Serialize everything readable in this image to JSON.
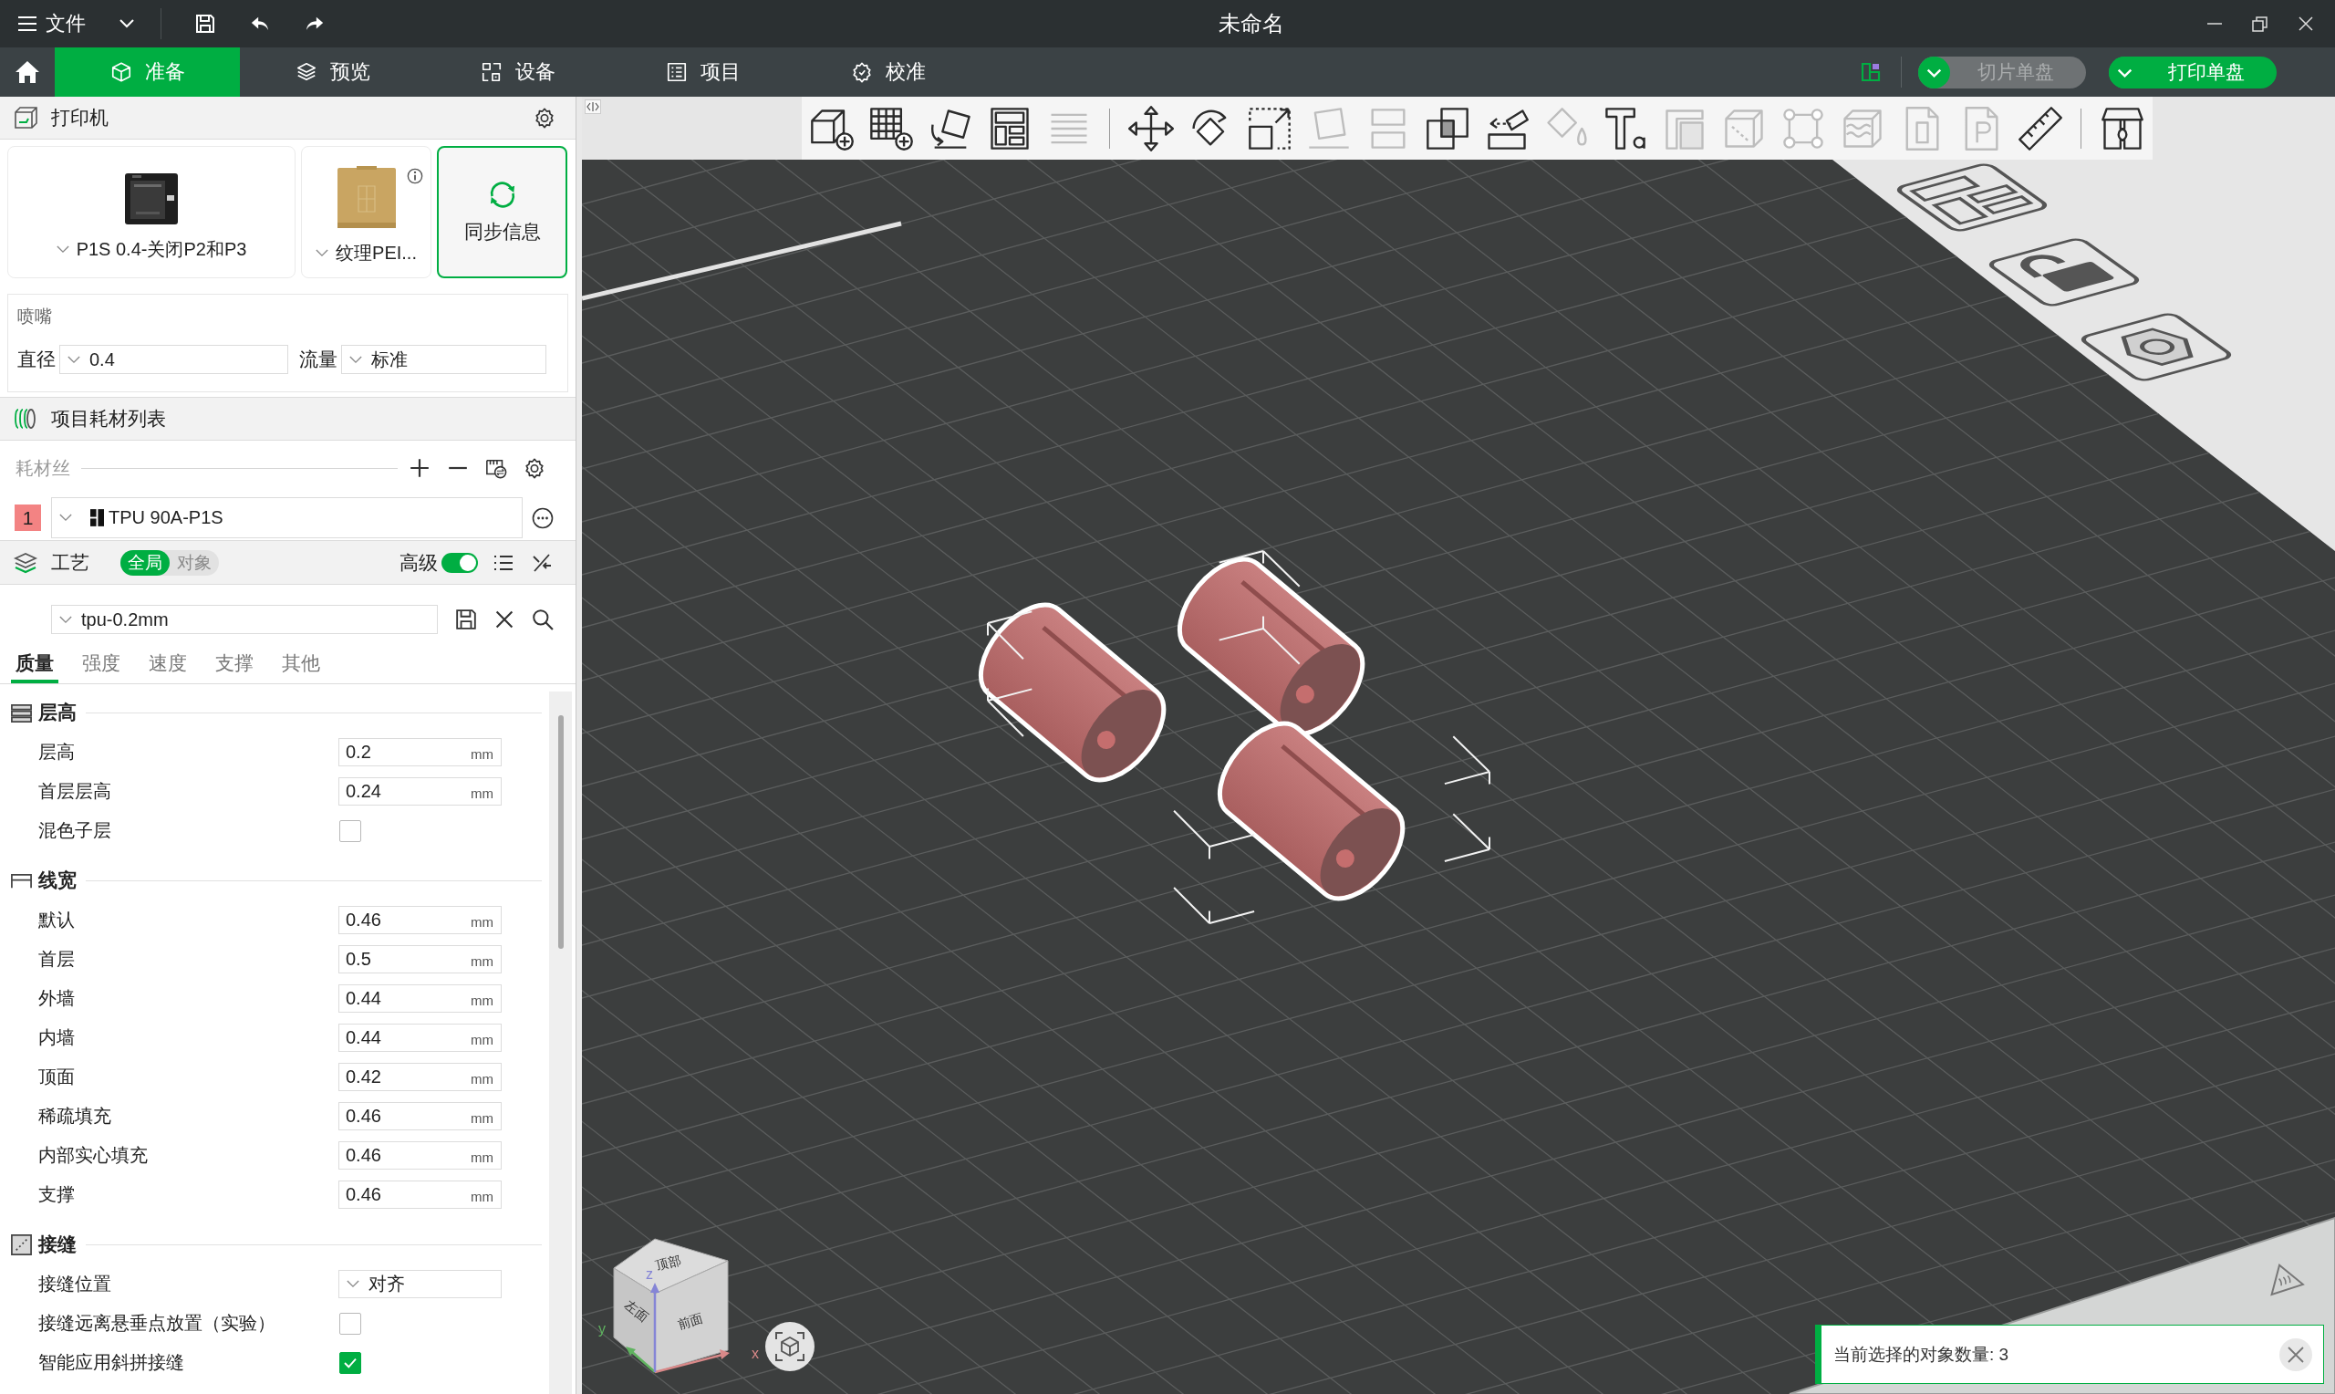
{
  "title_bar": {
    "menu": "文件",
    "title": "未命名"
  },
  "tabs": [
    {
      "label": "准备",
      "kind": "cube",
      "selected": true
    },
    {
      "label": "预览",
      "kind": "layers",
      "selected": false
    },
    {
      "label": "设备",
      "kind": "device",
      "selected": false
    },
    {
      "label": "项目",
      "kind": "list",
      "selected": false
    },
    {
      "label": "校准",
      "kind": "gauge",
      "selected": false
    }
  ],
  "plate_actions": [
    {
      "label": "切片单盘",
      "disabled": true
    },
    {
      "label": "打印单盘",
      "disabled": false
    }
  ],
  "printer": {
    "title": "打印机",
    "model": "P1S 0.4-关闭P2和P3",
    "plate": "纹理PEI...",
    "sync": "同步信息",
    "nozzle_title": "喷嘴",
    "nozzle_fields": [
      {
        "label": "直径",
        "value": "0.4"
      },
      {
        "label": "流量",
        "value": "标准"
      }
    ]
  },
  "filaments": {
    "title": "项目耗材列表",
    "subtitle": "耗材丝",
    "items": [
      {
        "number": "1",
        "name": "TPU 90A-P1S",
        "color": "#f38383"
      }
    ]
  },
  "process": {
    "title": "工艺",
    "scope": [
      {
        "label": "全局",
        "selected": true
      },
      {
        "label": "对象",
        "selected": false
      }
    ],
    "advanced": {
      "label": "高级",
      "on": true
    },
    "preset": "tpu-0.2mm",
    "tabs": [
      {
        "label": "质量",
        "selected": true
      },
      {
        "label": "强度",
        "selected": false
      },
      {
        "label": "速度",
        "selected": false
      },
      {
        "label": "支撑",
        "selected": false
      },
      {
        "label": "其他",
        "selected": false
      }
    ],
    "sections": [
      {
        "title": "层高",
        "kind": "layers",
        "rows": [
          {
            "kind": "number",
            "label": "层高",
            "value": "0.2",
            "unit": "mm"
          },
          {
            "kind": "number",
            "label": "首层层高",
            "value": "0.24",
            "unit": "mm"
          },
          {
            "kind": "checkbox",
            "label": "混色子层",
            "checked": false
          }
        ]
      },
      {
        "title": "线宽",
        "kind": "width",
        "rows": [
          {
            "kind": "number",
            "label": "默认",
            "value": "0.46",
            "unit": "mm"
          },
          {
            "kind": "number",
            "label": "首层",
            "value": "0.5",
            "unit": "mm"
          },
          {
            "kind": "number",
            "label": "外墙",
            "value": "0.44",
            "unit": "mm"
          },
          {
            "kind": "number",
            "label": "内墙",
            "value": "0.44",
            "unit": "mm"
          },
          {
            "kind": "number",
            "label": "顶面",
            "value": "0.42",
            "unit": "mm"
          },
          {
            "kind": "number",
            "label": "稀疏填充",
            "value": "0.46",
            "unit": "mm"
          },
          {
            "kind": "number",
            "label": "内部实心填充",
            "value": "0.46",
            "unit": "mm"
          },
          {
            "kind": "number",
            "label": "支撑",
            "value": "0.46",
            "unit": "mm"
          }
        ]
      },
      {
        "title": "接缝",
        "kind": "seam",
        "rows": [
          {
            "kind": "select",
            "label": "接缝位置",
            "value": "对齐"
          },
          {
            "kind": "checkbox",
            "label": "接缝远离悬垂点放置（实验）",
            "checked": false
          },
          {
            "kind": "checkbox",
            "label": "智能应用斜拼接缝",
            "checked": true
          }
        ]
      }
    ]
  },
  "viewport": {
    "toolbar": {
      "groups": [
        {
          "tools": [
            {
              "kind": "cube-plus",
              "disabled": false
            },
            {
              "kind": "grid-plus",
              "disabled": false
            },
            {
              "kind": "auto-orient",
              "disabled": false
            },
            {
              "kind": "arrange",
              "disabled": false
            },
            {
              "kind": "layer-lines",
              "disabled": true
            }
          ]
        },
        {
          "tools": [
            {
              "kind": "move",
              "disabled": false
            },
            {
              "kind": "rotate",
              "disabled": false
            },
            {
              "kind": "scale",
              "disabled": false
            },
            {
              "kind": "lay-face",
              "disabled": true
            },
            {
              "kind": "split",
              "disabled": true
            },
            {
              "kind": "boolean",
              "disabled": false
            },
            {
              "kind": "cut",
              "disabled": false
            },
            {
              "kind": "paint-drop",
              "disabled": true
            },
            {
              "kind": "text-tool",
              "disabled": false
            },
            {
              "kind": "support-paint",
              "disabled": true
            },
            {
              "kind": "seam-paint",
              "disabled": true
            },
            {
              "kind": "mesh-repair",
              "disabled": true
            },
            {
              "kind": "fuzzy-skin",
              "disabled": true
            },
            {
              "kind": "doc-zero",
              "disabled": true
            },
            {
              "kind": "doc-p",
              "disabled": true
            },
            {
              "kind": "ruler",
              "disabled": false
            }
          ]
        },
        {
          "tools": [
            {
              "kind": "assembly",
              "disabled": false
            }
          ]
        }
      ]
    },
    "objects": [
      {
        "selected": true
      },
      {
        "selected": true
      },
      {
        "selected": true
      }
    ],
    "view_cube": {
      "faces": [
        "顶部",
        "左面",
        "前面"
      ],
      "axes": [
        "x",
        "y",
        "z"
      ]
    },
    "notification": {
      "text": "当前选择的对象数量: 3"
    }
  }
}
